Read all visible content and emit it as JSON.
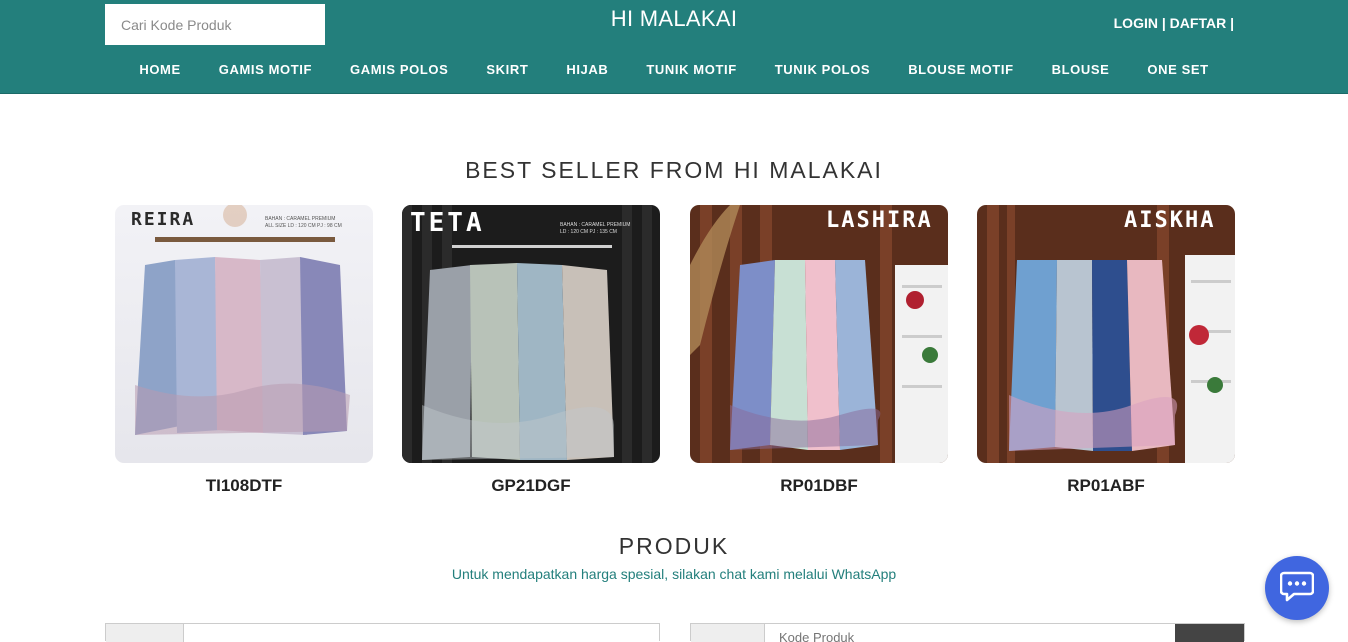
{
  "header": {
    "search_placeholder": "Cari Kode Produk",
    "brand": "HI MALAKAI",
    "login": "LOGIN",
    "daftar": "DAFTAR",
    "sep1": " | ",
    "sep2": " |",
    "nav": [
      "HOME",
      "GAMIS MOTIF",
      "GAMIS POLOS",
      "SKIRT",
      "HIJAB",
      "TUNIK MOTIF",
      "TUNIK POLOS",
      "BLOUSE MOTIF",
      "BLOUSE",
      "ONE SET"
    ]
  },
  "best_seller": {
    "title": "BEST SELLER FROM HI MALAKAI",
    "products": [
      {
        "code": "TI108DTF",
        "image_label": "REIRA",
        "caption": "BAHAN : CARAMEL PREMIUM",
        "caption2": "ALL SIZE LD : 120 CM PJ : 98 CM"
      },
      {
        "code": "GP21DGF",
        "image_label": "TETA",
        "caption": "BAHAN : CARAMEL PREMIUM",
        "caption2": "LD : 120 CM PJ : 135 CM"
      },
      {
        "code": "RP01DBF",
        "image_label": "LASHIRA",
        "caption": "",
        "caption2": ""
      },
      {
        "code": "RP01ABF",
        "image_label": "AISKHA",
        "caption": "",
        "caption2": ""
      }
    ]
  },
  "produk": {
    "title": "PRODUK",
    "subtitle": "Untuk mendapatkan harga spesial, silakan chat kami melalui WhatsApp",
    "search_placeholder": "Kode Produk"
  },
  "colors": {
    "header": "#237f7c",
    "chat_button": "#4066e0"
  },
  "icons": {
    "chat": "chat-bubble-icon"
  }
}
